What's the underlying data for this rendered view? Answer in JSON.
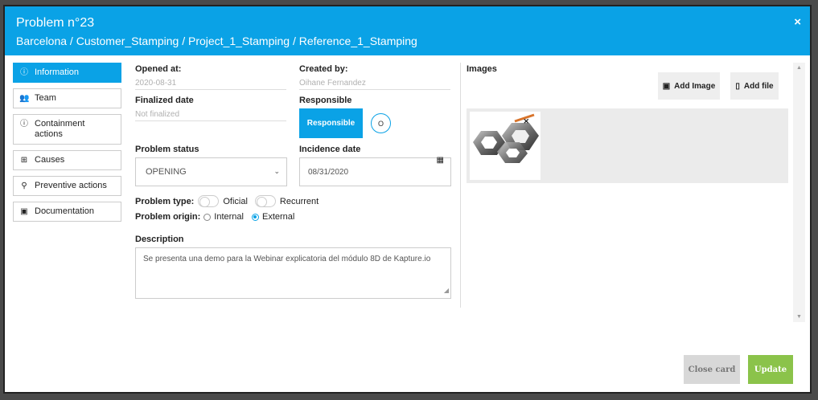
{
  "header": {
    "title": "Problem n°23",
    "path": "Barcelona / Customer_Stamping / Project_1_Stamping / Reference_1_Stamping",
    "close_icon": "×"
  },
  "sidebar": {
    "items": [
      {
        "icon": "ⓘ",
        "label": "Information",
        "active": true
      },
      {
        "icon": "👥",
        "label": "Team"
      },
      {
        "icon": "ⓘ",
        "label": "Containment actions"
      },
      {
        "icon": "⊞",
        "label": "Causes"
      },
      {
        "icon": "⚲",
        "label": "Preventive actions"
      },
      {
        "icon": "▣",
        "label": "Documentation"
      }
    ]
  },
  "form": {
    "opened_at_label": "Opened at:",
    "opened_at_value": "2020-08-31",
    "created_by_label": "Created by:",
    "created_by_value": "Oihane Fernandez",
    "finalized_label": "Finalized date",
    "finalized_value": "Not finalized",
    "responsible_label": "Responsible",
    "responsible_button": "Responsible",
    "responsible_circle": "O",
    "status_label": "Problem status",
    "status_value": "OPENING",
    "status_chevron": "⌄",
    "incidence_label": "Incidence date",
    "incidence_value": "08/31/2020",
    "calendar_icon": "▦",
    "type_label": "Problem type:",
    "type_option1": "Oficial",
    "type_option2": "Recurrent",
    "origin_label": "Problem origin:",
    "origin_option1": "Internal",
    "origin_option2": "External",
    "origin_selected": "External",
    "description_label": "Description",
    "description_value": "Se presenta una demo para la Webinar explicatoria del módulo 8D de Kapture.io"
  },
  "images": {
    "label": "Images",
    "add_image": "Add Image",
    "add_file": "Add file",
    "remove_icon": "✕"
  },
  "footer": {
    "close_card": "Close card",
    "update": "Update"
  },
  "colors": {
    "accent": "#0aa2e6",
    "update": "#8bc34a",
    "close_card": "#d8d8d8"
  }
}
